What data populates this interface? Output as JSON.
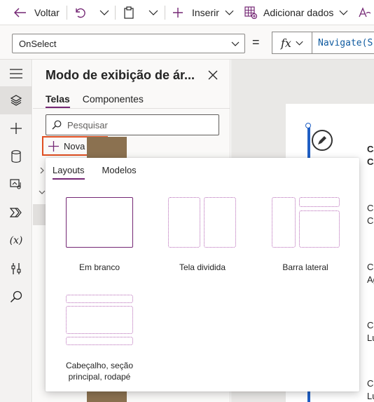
{
  "toolbar": {
    "back_label": "Voltar",
    "insert_label": "Inserir",
    "add_data_label": "Adicionar dados"
  },
  "formula_bar": {
    "property": "OnSelect",
    "equals": "=",
    "fx": "fx",
    "formula": "Navigate(S"
  },
  "tree_panel": {
    "title": "Modo de exibição de ár...",
    "tabs": [
      "Telas",
      "Componentes"
    ],
    "search_placeholder": "Pesquisar",
    "new_screen_label": "Nova tela"
  },
  "flyout": {
    "tabs": [
      "Layouts",
      "Modelos"
    ],
    "layouts": [
      {
        "name": "blank",
        "label": "Em branco"
      },
      {
        "name": "split",
        "label": "Tela dividida"
      },
      {
        "name": "sidebar",
        "label": "Barra lateral"
      },
      {
        "name": "header-main-footer",
        "label": "Cabeçalho, seção principal, rodapé"
      }
    ]
  },
  "canvas": {
    "cards": [
      {
        "line1": "Ca",
        "line2": "Ca"
      },
      {
        "line1": "Ca",
        "line2": "Ca"
      },
      {
        "line1": "Ca",
        "line2": "Ag"
      },
      {
        "line1": "Ca",
        "line2": "Lu"
      },
      {
        "line1": "Ca",
        "line2": "Lu"
      }
    ]
  },
  "colors": {
    "accent": "#742774",
    "highlight_border": "#e04e20",
    "selection": "#1f5fc4"
  },
  "icons": {
    "rail": [
      "hamburger-icon",
      "layers-icon",
      "plus-icon",
      "database-icon",
      "media-icon",
      "power-automate-icon",
      "variables-icon",
      "tools-icon",
      "search-icon"
    ]
  }
}
